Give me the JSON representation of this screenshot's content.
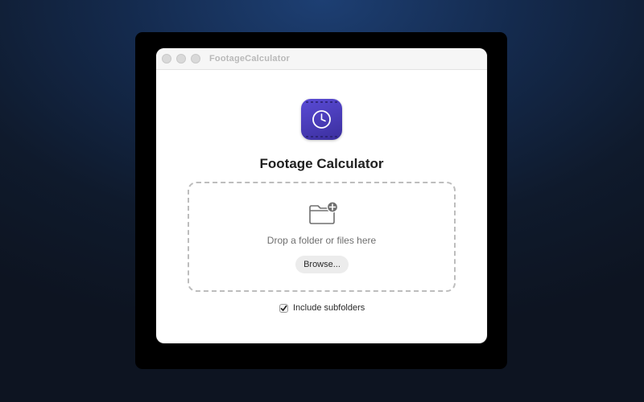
{
  "window": {
    "title": "FootageCalculator"
  },
  "app": {
    "icon": "film-clock-icon",
    "heading": "Footage Calculator"
  },
  "dropzone": {
    "icon": "folder-add-icon",
    "prompt": "Drop a folder or files here",
    "browse_label": "Browse..."
  },
  "options": {
    "include_subfolders_label": "Include subfolders",
    "include_subfolders_checked": true
  },
  "colors": {
    "icon_gradient_top": "#5a4bd6",
    "icon_gradient_bottom": "#3b2f9d"
  }
}
